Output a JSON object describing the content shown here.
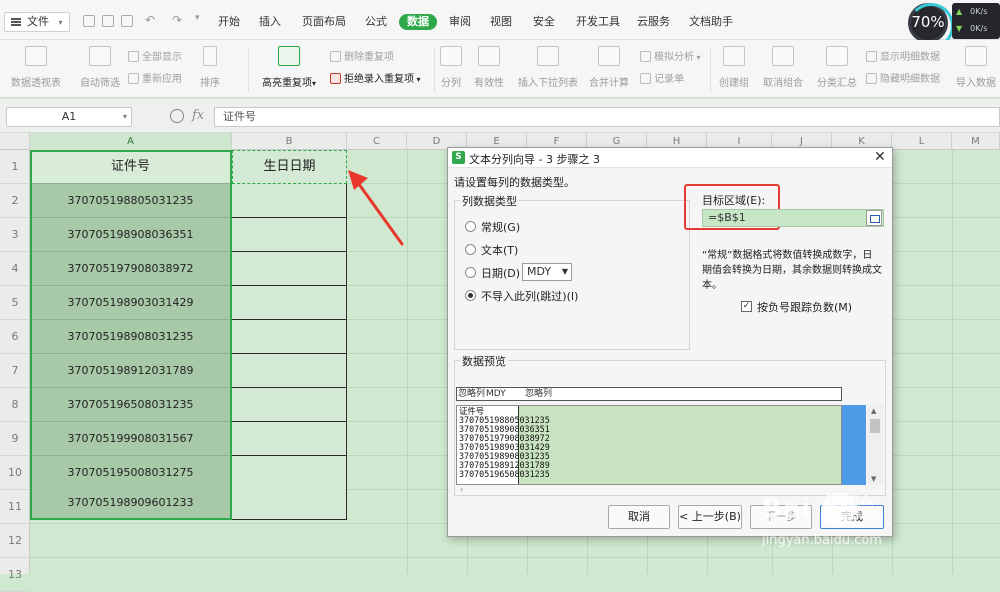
{
  "menubar": {
    "file_label": "文件",
    "tabs": [
      "开始",
      "插入",
      "页面布局",
      "公式",
      "数据",
      "审阅",
      "视图",
      "安全",
      "开发工具",
      "云服务",
      "文档助手"
    ],
    "active_tab": "数据",
    "gauge_percent": "70%",
    "net_speed_up": "0K/s",
    "net_speed_down": "0K/s"
  },
  "ribbon": {
    "pivot": "数据透视表",
    "autofilter": "自动筛选",
    "show_all": "全部显示",
    "reapply": "重新应用",
    "sort": "排序",
    "highlight_dup": "高亮重复项",
    "delete_dup": "删除重复项",
    "reject_dup": "拒绝录入重复项",
    "split": "分列",
    "validity": "有效性",
    "insert_dropdown": "插入下拉列表",
    "consolidate": "合并计算",
    "simulate": "模拟分析",
    "record": "记录单",
    "group": "创建组",
    "ungroup": "取消组合",
    "subtotal": "分类汇总",
    "show_detail": "显示明细数据",
    "hide_detail": "隐藏明细数据",
    "import": "导入数据"
  },
  "formula_bar": {
    "name_box": "A1",
    "fx": "fx",
    "value": "证件号"
  },
  "sheet": {
    "columns": [
      "A",
      "B",
      "C",
      "D",
      "E",
      "F",
      "G",
      "H",
      "I",
      "J",
      "K",
      "L",
      "M"
    ],
    "rows": [
      "1",
      "2",
      "3",
      "4",
      "5",
      "6",
      "7",
      "8",
      "9",
      "10",
      "11",
      "12",
      "13"
    ],
    "colA": [
      "证件号",
      "370705198805031235",
      "370705198908036351",
      "370705197908038972",
      "370705198903031429",
      "370705198908031235",
      "370705198912031789",
      "370705196508031235",
      "370705199908031567",
      "370705195008031275",
      "370705198909601233"
    ],
    "b1": "生日日期"
  },
  "dialog": {
    "title": "文本分列向导 - 3 步骤之 3",
    "icon_letter": "S",
    "prompt": "请设置每列的数据类型。",
    "group_label": "列数据类型",
    "options": [
      "常规(G)",
      "文本(T)",
      "日期(D)",
      "不导入此列(跳过)(I)"
    ],
    "selected_option": "不导入此列(跳过)(I)",
    "date_format": "MDY",
    "target_label": "目标区域(E):",
    "target_value": "=$B$1",
    "description": "“常规”数据格式将数值转换成数字，日期值会转换为日期，其余数据则转换成文本。",
    "description_lines": [
      "“常规”数据格式将数值转换成数字，日",
      "期值会转换为日期，其余数据则转换成文",
      "本。"
    ],
    "checkbox_label": "按负号跟踪负数(M)",
    "checkbox_checked": "true",
    "preview_label": "数据预览",
    "preview_header": [
      "忽略列",
      "MDY",
      "忽略列"
    ],
    "preview_rows": [
      "证件号",
      "370705198805031235",
      "370705198908036351",
      "370705197908038972",
      "370705198903031429",
      "370705198908031235",
      "370705198912031789",
      "370705196508031235"
    ],
    "btn_cancel": "取消",
    "btn_prev": "< 上一步(B)",
    "btn_next": "下一步",
    "btn_finish": "完成"
  },
  "watermark": {
    "main": "Bai 经验",
    "sub": "jingyan.baidu.com"
  }
}
